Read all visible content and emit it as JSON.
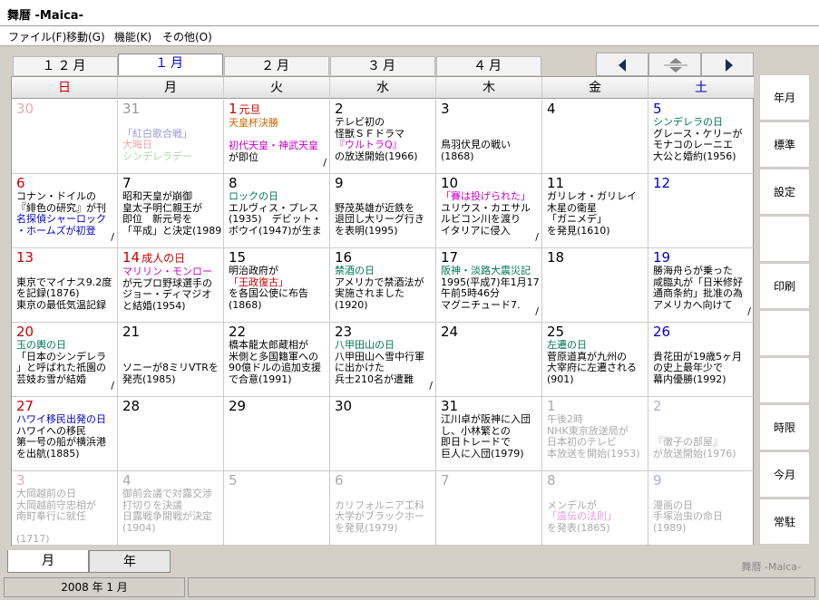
{
  "window": {
    "title": "舞暦 -Maica-"
  },
  "menu": [
    "ファイル(F)",
    "移動(G)",
    "機能(K)",
    "その他(O)"
  ],
  "month_tabs": [
    "１２月",
    "１月",
    "２月",
    "３月",
    "４月"
  ],
  "active_tab": 1,
  "weekdays": [
    {
      "label": "日",
      "color": "#cc0000"
    },
    {
      "label": "月",
      "color": "#000000"
    },
    {
      "label": "火",
      "color": "#000000"
    },
    {
      "label": "水",
      "color": "#000000"
    },
    {
      "label": "木",
      "color": "#000000"
    },
    {
      "label": "金",
      "color": "#000000"
    },
    {
      "label": "土",
      "color": "#0000cc"
    }
  ],
  "cells": [
    {
      "day": "30",
      "dim": true,
      "color": "#e8aaaa",
      "lines": []
    },
    {
      "day": "31",
      "dim": true,
      "color": "#999999",
      "lines": [
        {
          "t": ""
        },
        {
          "t": "「紅白歌合戦」",
          "c": "#9999dd"
        },
        {
          "t": "大晦日",
          "c": "#e8aaaa"
        },
        {
          "t": "シンデレラデー",
          "c": "#aad8aa"
        }
      ]
    },
    {
      "day": "1",
      "hol": "元旦",
      "color": "#cc0000",
      "lines": [
        {
          "t": "天皇杯決勝",
          "c": "#cc6600"
        },
        {
          "t": ""
        },
        {
          "t": "初代天皇・神武天皇",
          "c": "#cc00cc"
        },
        {
          "t": "が即位"
        }
      ],
      "mark": "/"
    },
    {
      "day": "2",
      "color": "#000000",
      "lines": [
        {
          "t": "テレビ初の"
        },
        {
          "t": "怪獣ＳＦドラマ"
        },
        {
          "t": "『ウルトラQ』",
          "c": "#cc00cc"
        },
        {
          "t": "の放送開始(1966)"
        }
      ]
    },
    {
      "day": "3",
      "color": "#000000",
      "lines": [
        {
          "t": ""
        },
        {
          "t": ""
        },
        {
          "t": "鳥羽伏見の戦い"
        },
        {
          "t": "(1868)"
        }
      ]
    },
    {
      "day": "4",
      "color": "#000000",
      "lines": []
    },
    {
      "day": "5",
      "color": "#0000cc",
      "lines": [
        {
          "t": "シンデレラの日",
          "c": "#007755"
        },
        {
          "t": "グレース・ケリーが"
        },
        {
          "t": "モナコのレーニエ"
        },
        {
          "t": "大公と婚約(1956)"
        }
      ]
    },
    {
      "day": "6",
      "color": "#cc0000",
      "lines": [
        {
          "t": "コナン・ドイルの"
        },
        {
          "t": "『緋色の研究』が刊"
        },
        {
          "t": "名探偵シャーロック",
          "c": "#0000cc"
        },
        {
          "t": "・ホームズが初登",
          "c": "#0000cc"
        }
      ],
      "mark": "/"
    },
    {
      "day": "7",
      "color": "#000000",
      "lines": [
        {
          "t": "昭和天皇が崩御"
        },
        {
          "t": "皇太子明仁親王が"
        },
        {
          "t": "即位　新元号を"
        },
        {
          "t": "「平成」と決定(1989"
        }
      ]
    },
    {
      "day": "8",
      "color": "#000000",
      "lines": [
        {
          "t": "ロックの日",
          "c": "#007755"
        },
        {
          "t": "エルヴィス・プレス"
        },
        {
          "t": "(1935)　デビット・"
        },
        {
          "t": "ボウイ(1947)が生ま"
        }
      ]
    },
    {
      "day": "9",
      "color": "#000000",
      "lines": [
        {
          "t": ""
        },
        {
          "t": "野茂英雄が近鉄を"
        },
        {
          "t": "退団し大リーグ行き"
        },
        {
          "t": "を表明(1995)"
        }
      ]
    },
    {
      "day": "10",
      "color": "#000000",
      "lines": [
        {
          "t": "「賽は投げられた」",
          "c": "#cc00cc"
        },
        {
          "t": "ユリウス・カエサル"
        },
        {
          "t": "ルビコン川を渡り"
        },
        {
          "t": "イタリアに侵入"
        }
      ],
      "mark": "/"
    },
    {
      "day": "11",
      "color": "#000000",
      "lines": [
        {
          "t": "ガリレオ・ガリレイ"
        },
        {
          "t": "木星の衛星"
        },
        {
          "t": "「ガニメデ」"
        },
        {
          "t": "を発見(1610)"
        }
      ]
    },
    {
      "day": "12",
      "color": "#0000cc",
      "lines": []
    },
    {
      "day": "13",
      "color": "#cc0000",
      "lines": [
        {
          "t": ""
        },
        {
          "t": "東京でマイナス9.2度"
        },
        {
          "t": "を記録(1876)"
        },
        {
          "t": "東京の最低気温記録"
        }
      ]
    },
    {
      "day": "14",
      "hol": "成人の日",
      "color": "#cc0000",
      "lines": [
        {
          "t": "マリリン・モンロー",
          "c": "#cc00cc"
        },
        {
          "t": "が元プロ野球選手の"
        },
        {
          "t": "ジョー・ディマジオ"
        },
        {
          "t": "と結婚(1954)"
        }
      ]
    },
    {
      "day": "15",
      "color": "#000000",
      "lines": [
        {
          "t": "明治政府が"
        },
        {
          "t": "「王政復古」",
          "c": "#cc0000"
        },
        {
          "t": "を各国公使に布告"
        },
        {
          "t": "(1868)"
        }
      ]
    },
    {
      "day": "16",
      "color": "#000000",
      "lines": [
        {
          "t": "禁酒の日",
          "c": "#007755"
        },
        {
          "t": "アメリカで禁酒法が"
        },
        {
          "t": "実施されました"
        },
        {
          "t": "(1920)"
        }
      ]
    },
    {
      "day": "17",
      "color": "#000000",
      "lines": [
        {
          "t": "阪神・淡路大震災記",
          "c": "#007755"
        },
        {
          "t": "1995(平成7)年1月17"
        },
        {
          "t": "午前5時46分"
        },
        {
          "t": "マグニチュード7."
        }
      ],
      "mark": "/"
    },
    {
      "day": "18",
      "color": "#000000",
      "lines": []
    },
    {
      "day": "19",
      "color": "#0000cc",
      "lines": [
        {
          "t": "勝海舟らが乗った"
        },
        {
          "t": "咸臨丸が「日米修好"
        },
        {
          "t": "通商条約」批准の為"
        },
        {
          "t": "アメリカへ向けて"
        }
      ],
      "mark": "/"
    },
    {
      "day": "20",
      "color": "#cc0000",
      "lines": [
        {
          "t": "玉の輿の日",
          "c": "#007755"
        },
        {
          "t": "「日本のシンデレラ"
        },
        {
          "t": "」と呼ばれた祇園の"
        },
        {
          "t": "芸妓お雪が結婚"
        }
      ],
      "mark": "/"
    },
    {
      "day": "21",
      "color": "#000000",
      "lines": [
        {
          "t": ""
        },
        {
          "t": ""
        },
        {
          "t": "ソニーが8ミリVTRを"
        },
        {
          "t": "発売(1985)"
        }
      ]
    },
    {
      "day": "22",
      "color": "#000000",
      "lines": [
        {
          "t": "橋本龍太郎蔵相が"
        },
        {
          "t": "米側と多国籍軍への"
        },
        {
          "t": "90億ドルの追加支援"
        },
        {
          "t": "で合意(1991)"
        }
      ]
    },
    {
      "day": "23",
      "color": "#000000",
      "lines": [
        {
          "t": "八甲田山の日",
          "c": "#007755"
        },
        {
          "t": "八甲田山へ雪中行軍"
        },
        {
          "t": "に出かけた"
        },
        {
          "t": "兵士210名が遭難"
        }
      ],
      "mark": "/"
    },
    {
      "day": "24",
      "color": "#000000",
      "lines": []
    },
    {
      "day": "25",
      "color": "#000000",
      "lines": [
        {
          "t": "左遷の日",
          "c": "#007755"
        },
        {
          "t": "菅原道真が九州の"
        },
        {
          "t": "大宰府に左遷される"
        },
        {
          "t": "(901)"
        }
      ]
    },
    {
      "day": "26",
      "color": "#0000cc",
      "lines": [
        {
          "t": ""
        },
        {
          "t": "貴花田が19歳5ヶ月"
        },
        {
          "t": "の史上最年少で"
        },
        {
          "t": "幕内優勝(1992)"
        }
      ]
    },
    {
      "day": "27",
      "color": "#cc0000",
      "lines": [
        {
          "t": "ハワイ移民出発の日",
          "c": "#0000cc"
        },
        {
          "t": "ハワイへの移民"
        },
        {
          "t": "第一号の船が横浜港"
        },
        {
          "t": "を出航(1885)"
        }
      ]
    },
    {
      "day": "28",
      "color": "#000000",
      "lines": []
    },
    {
      "day": "29",
      "color": "#000000",
      "lines": []
    },
    {
      "day": "30",
      "color": "#000000",
      "lines": []
    },
    {
      "day": "31",
      "color": "#000000",
      "lines": [
        {
          "t": "江川卓が阪神に入団"
        },
        {
          "t": "し、小林繁との"
        },
        {
          "t": "即日トレードで"
        },
        {
          "t": "巨人に入団(1979)"
        }
      ]
    },
    {
      "day": "1",
      "dim": true,
      "color": "#aaaaaa",
      "lines": [
        {
          "t": "午後2時",
          "c": "#aaaaaa"
        },
        {
          "t": "NHK東京放送局が",
          "c": "#aaaaaa"
        },
        {
          "t": "日本初のテレビ",
          "c": "#aaaaaa"
        },
        {
          "t": "本放送を開始(1953)",
          "c": "#aaaaaa"
        }
      ]
    },
    {
      "day": "2",
      "dim": true,
      "color": "#aab0e0",
      "lines": [
        {
          "t": ""
        },
        {
          "t": ""
        },
        {
          "t": "『徹子の部屋』",
          "c": "#aaaaaa"
        },
        {
          "t": "が放送開始(1976)",
          "c": "#aaaaaa"
        }
      ]
    },
    {
      "day": "3",
      "dim": true,
      "color": "#e8aaaa",
      "lines": [
        {
          "t": "大岡越前の日",
          "c": "#aaaaaa"
        },
        {
          "t": "大岡越前守忠相が",
          "c": "#aaaaaa"
        },
        {
          "t": "南町奉行に就任",
          "c": "#aaaaaa"
        },
        {
          "t": ""
        },
        {
          "t": "(1717)",
          "c": "#aaaaaa"
        }
      ]
    },
    {
      "day": "4",
      "dim": true,
      "color": "#aaaaaa",
      "lines": [
        {
          "t": "御前会議で対露交渉",
          "c": "#aaaaaa"
        },
        {
          "t": "打切りを決議",
          "c": "#aaaaaa"
        },
        {
          "t": "日露戦争開戦が決定",
          "c": "#aaaaaa"
        },
        {
          "t": "(1904)",
          "c": "#aaaaaa"
        }
      ]
    },
    {
      "day": "5",
      "dim": true,
      "color": "#aaaaaa",
      "lines": []
    },
    {
      "day": "6",
      "dim": true,
      "color": "#aaaaaa",
      "lines": [
        {
          "t": ""
        },
        {
          "t": "カリフォルニア工科",
          "c": "#aaaaaa"
        },
        {
          "t": "大学がブラックホー",
          "c": "#aaaaaa"
        },
        {
          "t": "を発見(1979)",
          "c": "#aaaaaa"
        }
      ]
    },
    {
      "day": "7",
      "dim": true,
      "color": "#aaaaaa",
      "lines": []
    },
    {
      "day": "8",
      "dim": true,
      "color": "#aaaaaa",
      "lines": [
        {
          "t": ""
        },
        {
          "t": "メンデルが",
          "c": "#aaaaaa"
        },
        {
          "t": "「遺伝の法則」",
          "c": "#e0a0e0"
        },
        {
          "t": "を発表(1865)",
          "c": "#aaaaaa"
        }
      ]
    },
    {
      "day": "9",
      "dim": true,
      "color": "#aab0e0",
      "lines": [
        {
          "t": ""
        },
        {
          "t": "漫画の日",
          "c": "#aaaaaa"
        },
        {
          "t": "手塚治虫の命日",
          "c": "#aaaaaa"
        },
        {
          "t": "(1989)",
          "c": "#aaaaaa"
        }
      ]
    }
  ],
  "sidebar": [
    "年月",
    "標準",
    "設定",
    "",
    "印刷",
    "",
    "",
    "時限",
    "今月",
    "常駐"
  ],
  "view_tabs": [
    "月",
    "年"
  ],
  "app_label": "舞暦 -Maica-",
  "status": {
    "date": "2008 年 1 月",
    "message": ""
  }
}
